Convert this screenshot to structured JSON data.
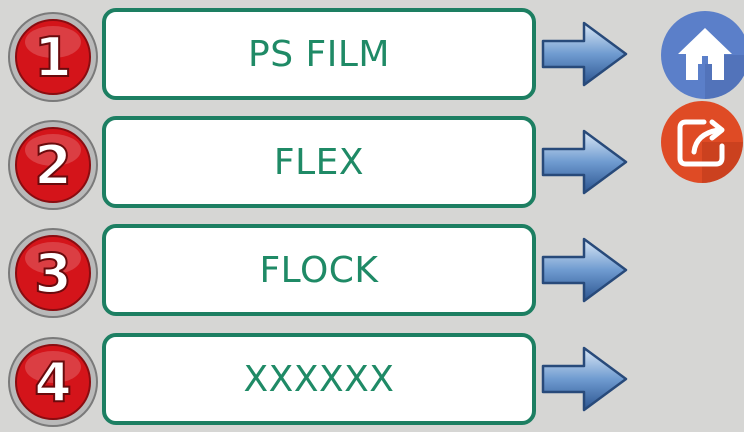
{
  "options": [
    {
      "number": "1",
      "label": "PS FILM"
    },
    {
      "number": "2",
      "label": "FLEX"
    },
    {
      "number": "3",
      "label": "FLOCK"
    },
    {
      "number": "4",
      "label": "XXXXXX"
    }
  ],
  "icons": {
    "number_badge": "red-number-circle-icon",
    "arrow": "blue-right-arrow-icon",
    "home": "home-icon",
    "share": "share-icon"
  },
  "colors": {
    "background": "#d6d6d4",
    "option_border": "#1d7f62",
    "option_text": "#1f8a66",
    "badge_red": "#d4141a",
    "home_blue": "#5b7fc9",
    "share_orange": "#df4b25"
  }
}
